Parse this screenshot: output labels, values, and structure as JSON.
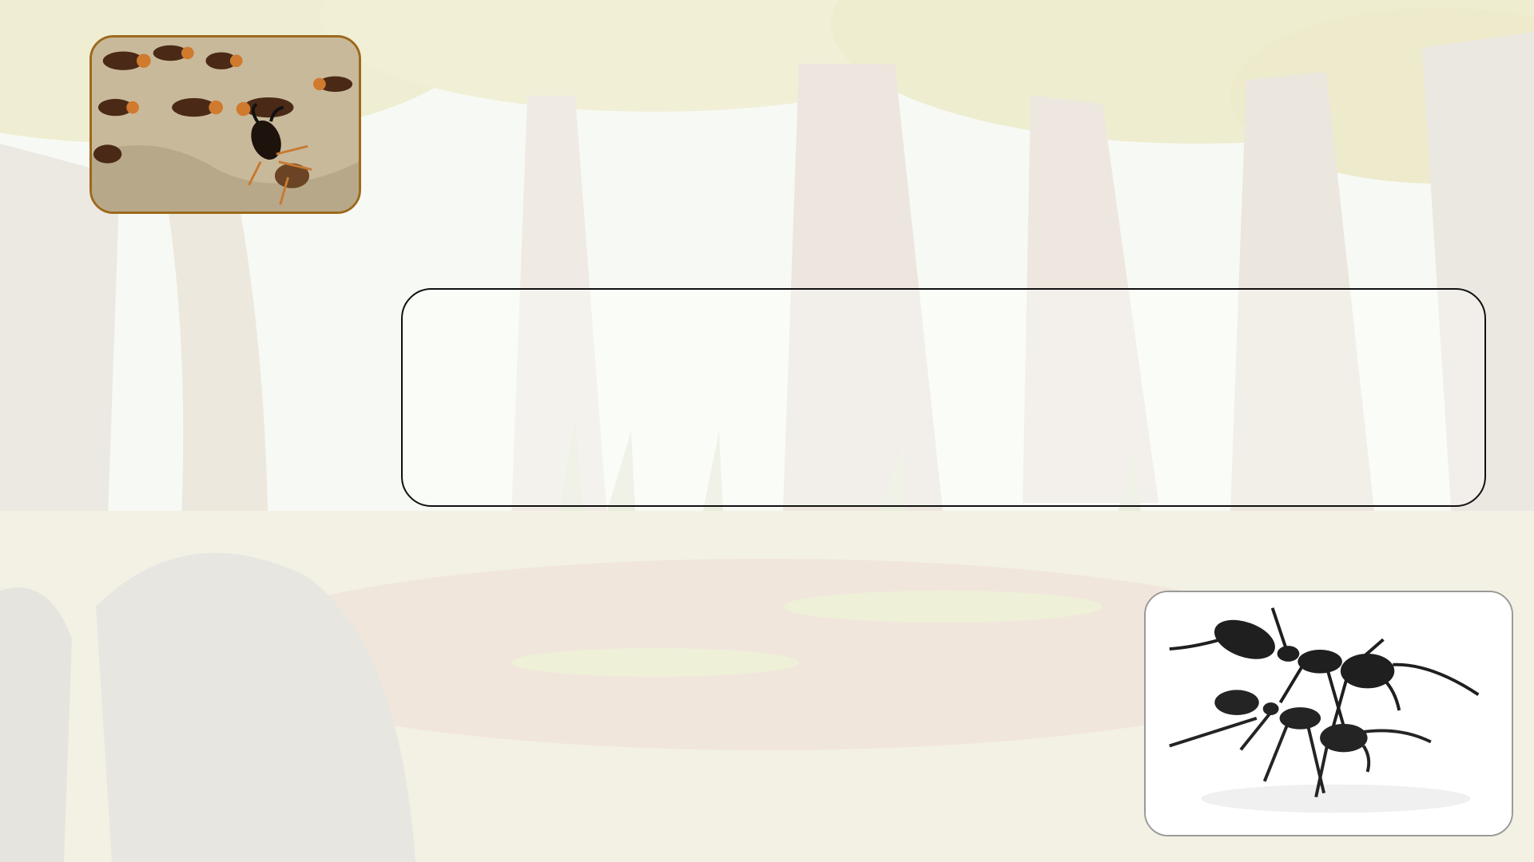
{
  "slide": {
    "background": "forest-cartoon-background",
    "background_tint": "#f6f7ef",
    "top_image": {
      "icon": "termites-photo",
      "border_color": "#9c6a1c"
    },
    "text_box": {
      "content": ""
    },
    "bottom_image": {
      "icon": "ants-photo",
      "border_color": "#9a9a9a"
    }
  }
}
